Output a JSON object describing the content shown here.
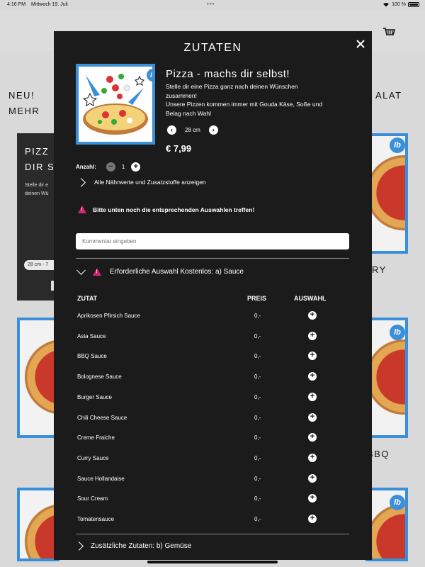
{
  "status_bar": {
    "time": "4:16 PM",
    "date": "Mittwoch 19. Juli",
    "battery": "100 %"
  },
  "background": {
    "nav_new": "NEU!",
    "nav_more": "MEHR",
    "nav_salad": "ALAT",
    "card_title_1": "PIZZ",
    "card_title_2": "DIR S",
    "card_desc_1": "Stelle dir e",
    "card_desc_2": "deinen Wü",
    "card_size": "28 cm - 7",
    "label_ry": "RY",
    "label_bbq": "BBQ",
    "badge": "lb"
  },
  "modal": {
    "title": "ZUTATEN",
    "product": {
      "name": "Pizza - machs dir selbst!",
      "desc_line1": "Stelle dir eine Pizza ganz nach deinen Wünschen",
      "desc_line2": "zusammen!",
      "desc_line3": "Unsere Pizzen kommen immer mit Gouda Käse, Soße und",
      "desc_line4": "Belag nach Wahl",
      "size": "28 cm",
      "price": "€ 7,99",
      "badge": "lb"
    },
    "quantity": {
      "label": "Anzahl:",
      "value": "1"
    },
    "nutrition_link": "Alle Nährwerte und Zusatzstoffe anzeigen",
    "warning": "Bitte unten noch die entsprechenden Auswahlen treffen!",
    "comment_placeholder": "Kommentar eingeben",
    "section_sauce": "Erforderliche Auswahl Kostenlos: a) Sauce",
    "table_headers": {
      "ingredient": "ZUTAT",
      "price": "PREIS",
      "choice": "AUSWAHL"
    },
    "sauces": [
      {
        "name": "Aprikosen Pfirsich Sauce",
        "price": "0,-"
      },
      {
        "name": "Asia Sauce",
        "price": "0,-"
      },
      {
        "name": "BBQ Sauce",
        "price": "0,-"
      },
      {
        "name": "Bolognese Sauce",
        "price": "0,-"
      },
      {
        "name": "Burger Sauce",
        "price": "0,-"
      },
      {
        "name": "Chili Cheese Sauce",
        "price": "0,-"
      },
      {
        "name": "Creme Fraiche",
        "price": "0,-"
      },
      {
        "name": "Curry Sauce",
        "price": "0,-"
      },
      {
        "name": "Sauce Hollandaise",
        "price": "0,-"
      },
      {
        "name": "Sour Cream",
        "price": "0,-"
      },
      {
        "name": "Tomatensauce",
        "price": "0,-"
      }
    ],
    "section_veg": "Zusätzliche Zutaten: b) Gemüse"
  },
  "colors": {
    "accent_blue": "#3b8fd9",
    "warning_pink": "#d6237a",
    "modal_bg": "#1b1b1b"
  }
}
